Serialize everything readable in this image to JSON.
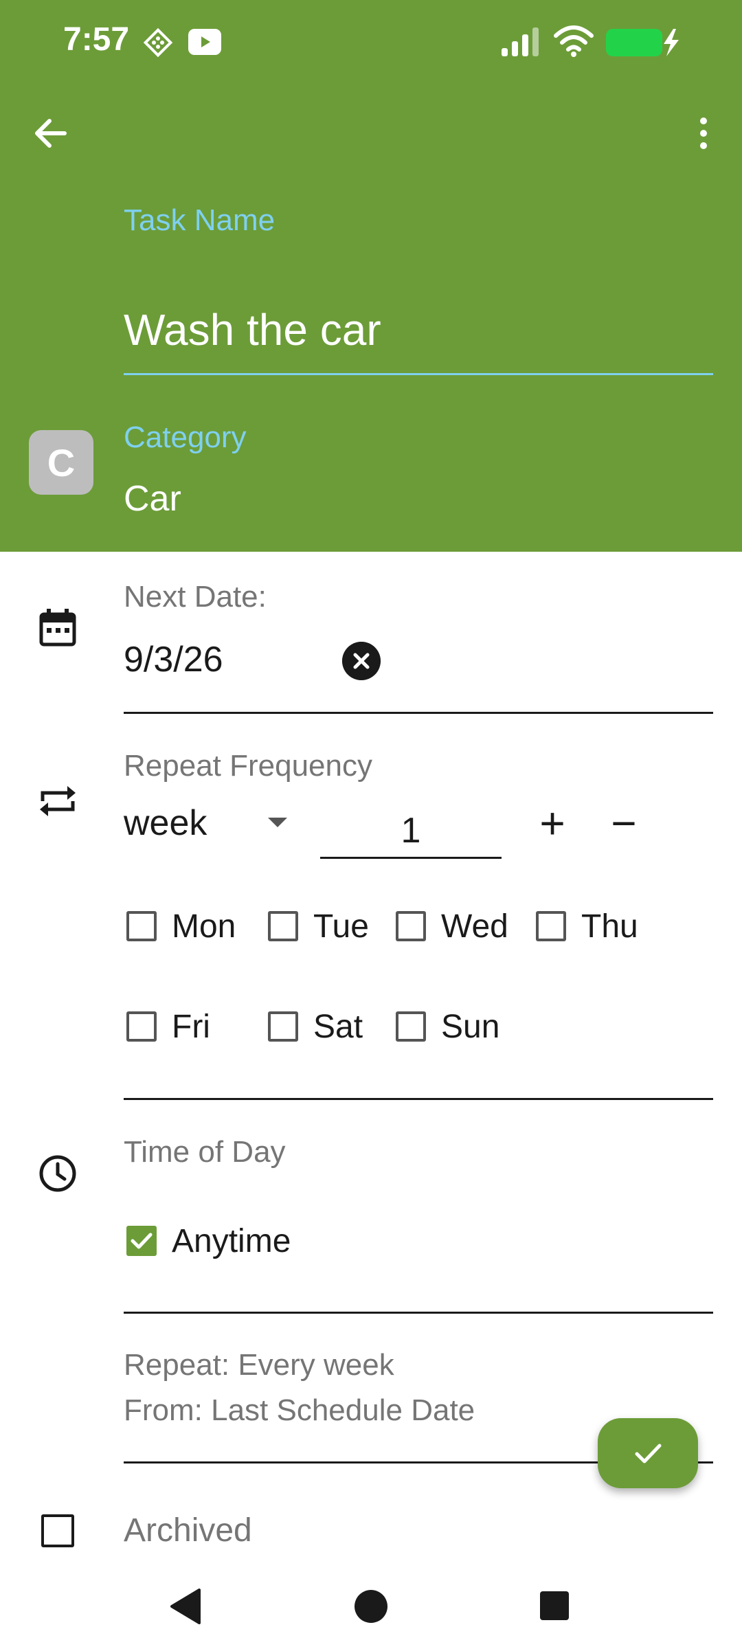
{
  "status_bar": {
    "time": "7:57"
  },
  "task": {
    "label": "Task Name",
    "value": "Wash the car"
  },
  "category": {
    "avatar_letter": "C",
    "label": "Category",
    "value": "Car"
  },
  "next_date": {
    "label": "Next Date:",
    "value": "9/3/26"
  },
  "repeat": {
    "label": "Repeat Frequency",
    "unit": "week",
    "count": "1",
    "plus": "+",
    "minus": "−",
    "days": [
      {
        "label": "Mon",
        "checked": false
      },
      {
        "label": "Tue",
        "checked": false
      },
      {
        "label": "Wed",
        "checked": false
      },
      {
        "label": "Thu",
        "checked": false
      },
      {
        "label": "Fri",
        "checked": false
      },
      {
        "label": "Sat",
        "checked": false
      },
      {
        "label": "Sun",
        "checked": false
      }
    ]
  },
  "time_of_day": {
    "label": "Time of Day",
    "option": "Anytime",
    "checked": true
  },
  "summary": {
    "line1": "Repeat: Every week",
    "line2": "From: Last Schedule Date"
  },
  "archived": {
    "label": "Archived",
    "checked": false
  },
  "colors": {
    "header": "#6c9c38",
    "accent_label": "#7fd0f0",
    "avatar": "#bdbdbd"
  },
  "icons": [
    "back-arrow-icon",
    "more-vert-icon",
    "calendar-icon",
    "repeat-icon",
    "clock-icon",
    "check-icon"
  ]
}
